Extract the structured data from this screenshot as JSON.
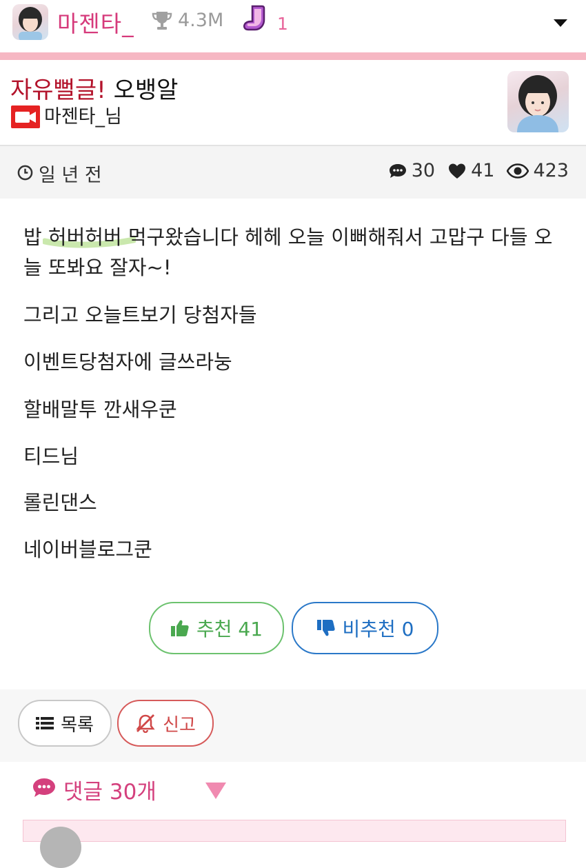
{
  "topbar": {
    "name": "마젠타_",
    "stat": "4.3M",
    "count": "1",
    "icons": [
      "avatar",
      "trophy-icon",
      "sock-icon",
      "chevron-down-icon"
    ]
  },
  "post": {
    "category": "자유뻘글!",
    "subject": "오뱅알",
    "author": "마젠타_님",
    "author_icon": "video-camera-icon"
  },
  "meta": {
    "time": "일 년 전",
    "comments": "30",
    "likes": "41",
    "views": "423"
  },
  "body": {
    "paragraphs": [
      "밥 허버허버 먹구왔습니다 헤헤 오늘 이뻐해줘서 고맙구 다들 오늘 또봐요 잘자~!",
      "그리고 오늘트보기 당첨자들",
      "이벤트당첨자에 글쓰라눙",
      "할배말투 깐새우쿤",
      "티드님",
      "롤린댄스",
      "네이버블로그쿤"
    ]
  },
  "votes": {
    "up_label": "추천 41",
    "down_label": "비추천 0"
  },
  "actions": {
    "list_label": "목록",
    "report_label": "신고"
  },
  "comments": {
    "title": "댓글 30개"
  },
  "colors": {
    "brand_pink": "#d63a7b",
    "rule_pink": "#f6b7c3",
    "category_red": "#b3132b",
    "vote_green": "#4aa84f",
    "vote_blue": "#1e6ec2",
    "report_red": "#d04848"
  }
}
